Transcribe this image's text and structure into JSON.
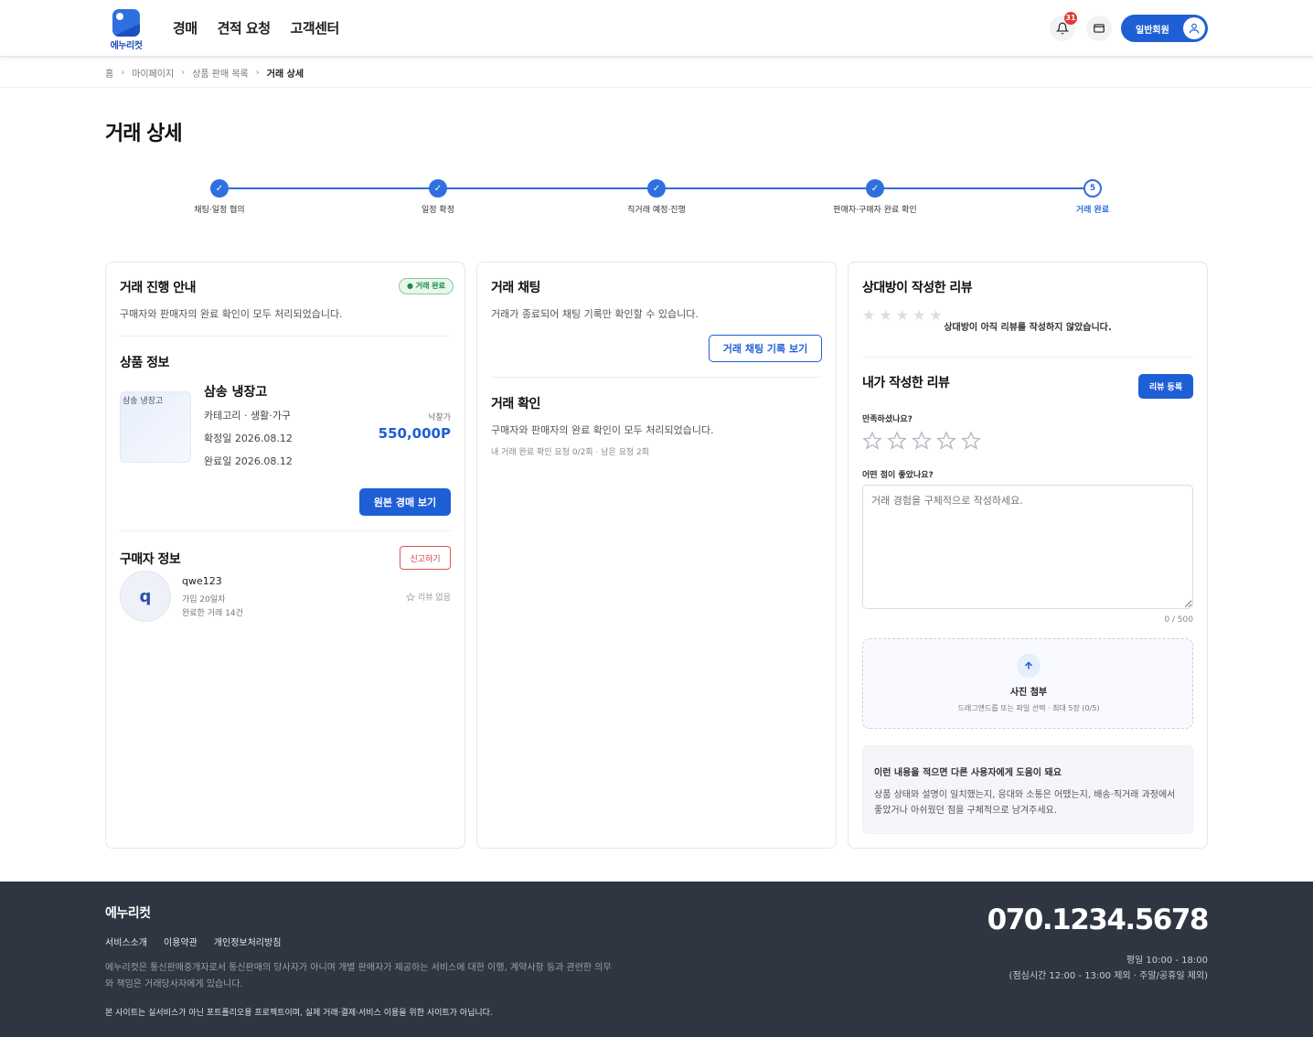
{
  "header": {
    "logo_text": "에누리컷",
    "nav": [
      "경매",
      "견적 요청",
      "고객센터"
    ],
    "notification_count": "31",
    "member_label": "일반회원"
  },
  "breadcrumb": [
    "홈",
    "마이페이지",
    "상품 판매 목록",
    "거래 상세"
  ],
  "page_title": "거래 상세",
  "stepper": {
    "steps": [
      "채팅·일정 협의",
      "일정 확정",
      "직거래 예정·진행",
      "판매자·구매자 완료 확인",
      "거래 완료"
    ],
    "current_number": "5"
  },
  "progress": {
    "title": "거래 진행 안내",
    "status": "● 거래 완료",
    "desc": "구매자와 판매자의 완료 확인이 모두 처리되었습니다."
  },
  "product": {
    "section_title": "상품 정보",
    "image_alt": "삼송 냉장고",
    "name": "삼송 냉장고",
    "category": "카테고리 · 생활·가구",
    "confirmed": "확정일 2026.08.12",
    "completed": "완료일 2026.08.12",
    "price_label": "낙찰가",
    "price": "550,000P",
    "view_button": "원본 경매 보기"
  },
  "buyer": {
    "section_title": "구매자 정보",
    "report_button": "신고하기",
    "initial": "q",
    "name": "qwe123",
    "joined": "가입 20일차",
    "trades": "완료한 거래 14건",
    "review": "리뷰 없음"
  },
  "chat": {
    "title": "거래 채팅",
    "desc": "거래가 종료되어 채팅 기록만 확인할 수 있습니다.",
    "history_button": "거래 채팅 기록 보기"
  },
  "confirm": {
    "title": "거래 확인",
    "desc": "구매자와 판매자의 완료 확인이 모두 처리되었습니다.",
    "meta": "내 거래 완료 확인 요청 0/2회 · 남은 요청 2회"
  },
  "review_other": {
    "title": "상대방이 작성한 리뷰",
    "empty": "상대방이 아직 리뷰를 작성하지 않았습니다."
  },
  "review_mine": {
    "title": "내가 작성한 리뷰",
    "submit_button": "리뷰 등록",
    "satisfaction_label": "만족하셨나요?",
    "good_label": "어떤 점이 좋았나요?",
    "placeholder": "거래 경험을 구체적으로 작성하세요.",
    "char_count": "0 / 500",
    "upload_title": "사진 첨부",
    "upload_sub": "드래그앤드롭 또는 파일 선택 · 최대 5장 (0/5)",
    "tip_title": "이런 내용을 적으면 다른 사용자에게 도움이 돼요",
    "tip_body": "상품 상태와 설명이 일치했는지, 응대와 소통은 어땠는지, 배송·직거래 과정에서 좋았거나 아쉬웠던 점을 구체적으로 남겨주세요."
  },
  "footer": {
    "logo": "에누리컷",
    "links": [
      "서비스소개",
      "이용약관",
      "개인정보처리방침"
    ],
    "disclaimer": "에누리컷은 통신판매중개자로서 통신판매의 당사자가 아니며 개별 판매자가 제공하는 서비스에 대한 이행, 계약사항 등과 관련한 의무와 책임은 거래당사자에게 있습니다.",
    "notice": "본 사이트는 실서비스가 아닌 포트폴리오용 프로젝트이며, 실제 거래·결제·서비스 이용을 위한 사이트가 아닙니다.",
    "phone": "070.1234.5678",
    "hours": "평일 10:00 - 18:00",
    "hours_note": "(점심시간 12:00 - 13:00 제외 · 주말/공휴일 제외)"
  },
  "colors": {
    "accent": "#1f5fd6",
    "success": "#1e8a45",
    "danger": "#d63c3c",
    "footer_bg": "#2f3541"
  }
}
